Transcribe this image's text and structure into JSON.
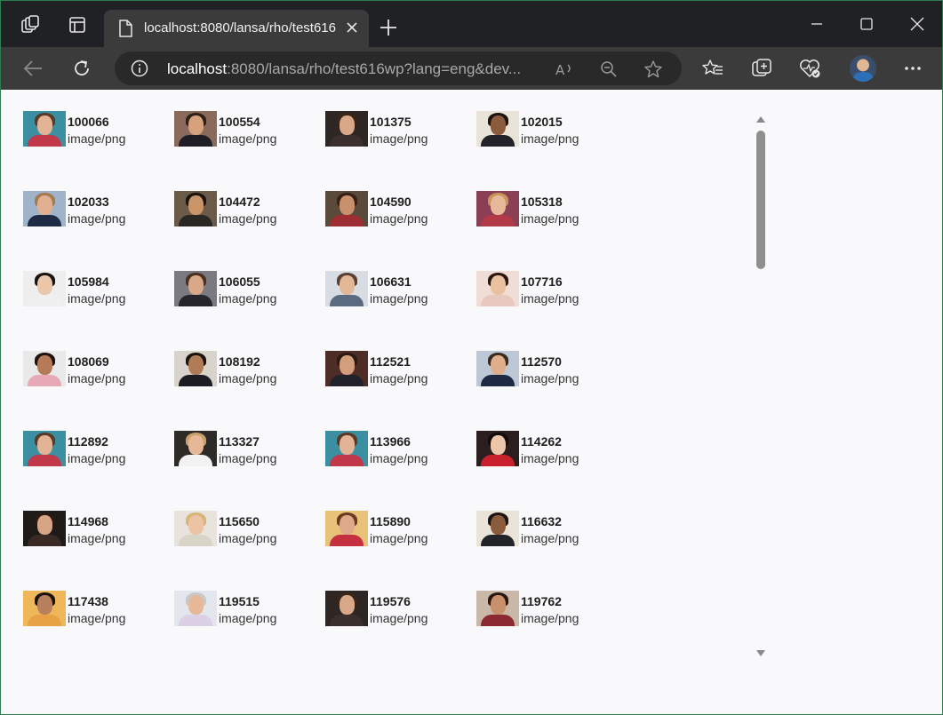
{
  "browser": {
    "tab_title": "localhost:8080/lansa/rho/test616",
    "url_host": "localhost",
    "url_rest": ":8080/lansa/rho/test616wp?lang=eng&dev..."
  },
  "items": [
    {
      "id": "100066",
      "type": "image/png",
      "skin": "#e2b394",
      "hair": "#5a3a26",
      "body": "#c0384a",
      "bg": "#3c8fa0"
    },
    {
      "id": "100554",
      "type": "image/png",
      "skin": "#d6a27e",
      "hair": "#2e1f17",
      "body": "#1e1e24",
      "bg": "#8a6a5a"
    },
    {
      "id": "101375",
      "type": "image/png",
      "skin": "#d9a889",
      "hair": "#3b2518",
      "body": "#3a2f2c",
      "bg": "#2d2623"
    },
    {
      "id": "102015",
      "type": "image/png",
      "skin": "#8b5b3e",
      "hair": "#1c1410",
      "body": "#23232a",
      "bg": "#e9e3d8"
    },
    {
      "id": "102033",
      "type": "image/png",
      "skin": "#e0b090",
      "hair": "#a47a52",
      "body": "#1f2a45",
      "bg": "#9fb4c9"
    },
    {
      "id": "104472",
      "type": "image/png",
      "skin": "#c99468",
      "hair": "#1a1310",
      "body": "#2a2622",
      "bg": "#6b5a48"
    },
    {
      "id": "104590",
      "type": "image/png",
      "skin": "#c9906e",
      "hair": "#3a2014",
      "body": "#9c2e34",
      "bg": "#5a4a3a"
    },
    {
      "id": "105318",
      "type": "image/png",
      "skin": "#e7b99a",
      "hair": "#c7955a",
      "body": "#b23a48",
      "bg": "#8a3f55"
    },
    {
      "id": "105984",
      "type": "image/png",
      "skin": "#eac7ab",
      "hair": "#1a1410",
      "body": "#f0f0f0",
      "bg": "#eeeeee"
    },
    {
      "id": "106055",
      "type": "image/png",
      "skin": "#d9a888",
      "hair": "#4a3020",
      "body": "#26262c",
      "bg": "#7a7a80"
    },
    {
      "id": "106631",
      "type": "image/png",
      "skin": "#e2b898",
      "hair": "#5a4030",
      "body": "#5a6a80",
      "bg": "#d8dde3"
    },
    {
      "id": "107716",
      "type": "image/png",
      "skin": "#e9c0a0",
      "hair": "#2a1810",
      "body": "#e7c9c0",
      "bg": "#f0ddd6"
    },
    {
      "id": "108069",
      "type": "image/png",
      "skin": "#b57a58",
      "hair": "#1f140f",
      "body": "#e7a9b5",
      "bg": "#e9e9e9"
    },
    {
      "id": "108192",
      "type": "image/png",
      "skin": "#b07c58",
      "hair": "#1a1410",
      "body": "#1c1c22",
      "bg": "#d8d4cc"
    },
    {
      "id": "112521",
      "type": "image/png",
      "skin": "#d39e7c",
      "hair": "#2a1a12",
      "body": "#22222a",
      "bg": "#4e2d26"
    },
    {
      "id": "112570",
      "type": "image/png",
      "skin": "#e0ae8c",
      "hair": "#3a2a20",
      "body": "#1e2a44",
      "bg": "#bcc8d6"
    },
    {
      "id": "112892",
      "type": "image/png",
      "skin": "#e2b394",
      "hair": "#5a3a26",
      "body": "#c0384a",
      "bg": "#3c8fa0"
    },
    {
      "id": "113327",
      "type": "image/png",
      "skin": "#e6b898",
      "hair": "#c8a06a",
      "body": "#f2f2f2",
      "bg": "#2e2a28"
    },
    {
      "id": "113966",
      "type": "image/png",
      "skin": "#e2b394",
      "hair": "#5a3a26",
      "body": "#c0384a",
      "bg": "#3c8fa0"
    },
    {
      "id": "114262",
      "type": "image/png",
      "skin": "#ecc6a8",
      "hair": "#120c0a",
      "body": "#c8202c",
      "bg": "#2a1e1e"
    },
    {
      "id": "114968",
      "type": "image/png",
      "skin": "#d8a486",
      "hair": "#2a1a12",
      "body": "#3a2a26",
      "bg": "#1e1a18"
    },
    {
      "id": "115650",
      "type": "image/png",
      "skin": "#ecc4a4",
      "hair": "#d8b478",
      "body": "#d9d4c8",
      "bg": "#e8e4dc"
    },
    {
      "id": "115890",
      "type": "image/png",
      "skin": "#dea88a",
      "hair": "#6a3a22",
      "body": "#c43040",
      "bg": "#e9c27a"
    },
    {
      "id": "116632",
      "type": "image/png",
      "skin": "#8b5b3e",
      "hair": "#1c1410",
      "body": "#23232a",
      "bg": "#e9e3d8"
    },
    {
      "id": "117438",
      "type": "image/png",
      "skin": "#b8805c",
      "hair": "#1a120e",
      "body": "#e6a244",
      "bg": "#eeb85a"
    },
    {
      "id": "119515",
      "type": "image/png",
      "skin": "#e6b898",
      "hair": "#c8c8c8",
      "body": "#dcd0e6",
      "bg": "#e3e6ec"
    },
    {
      "id": "119576",
      "type": "image/png",
      "skin": "#d9a889",
      "hair": "#3b2518",
      "body": "#3a2f2c",
      "bg": "#2d2623"
    },
    {
      "id": "119762",
      "type": "image/png",
      "skin": "#c9906e",
      "hair": "#2a1810",
      "body": "#8c2a34",
      "bg": "#c9b8a8"
    }
  ]
}
